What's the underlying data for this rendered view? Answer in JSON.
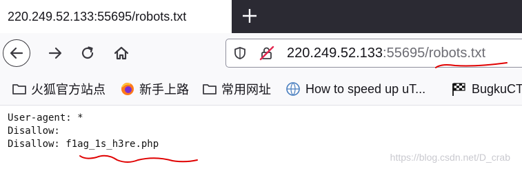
{
  "tab": {
    "title": "220.249.52.133:55695/robots.txt"
  },
  "url": {
    "host": "220.249.52.133",
    "port": ":55695",
    "path": "/robots.txt"
  },
  "bookmarks": [
    {
      "label": "火狐官方站点",
      "icon": "folder-icon"
    },
    {
      "label": "新手上路",
      "icon": "firefox-icon"
    },
    {
      "label": "常用网址",
      "icon": "folder-icon"
    },
    {
      "label": "How to speed up uT...",
      "icon": "globe-icon"
    },
    {
      "label": "BugkuCT",
      "icon": "checkered-flag-icon"
    }
  ],
  "content": {
    "line1": "User-agent: *",
    "line2": "Disallow:",
    "line3_prefix": "Disallow: ",
    "line3_file": "f1ag_1s_h3re.php"
  },
  "watermark": "https://blog.csdn.net/D_crab",
  "colors": {
    "annotation": "#e00000",
    "tabstrip": "#2b2a33"
  }
}
